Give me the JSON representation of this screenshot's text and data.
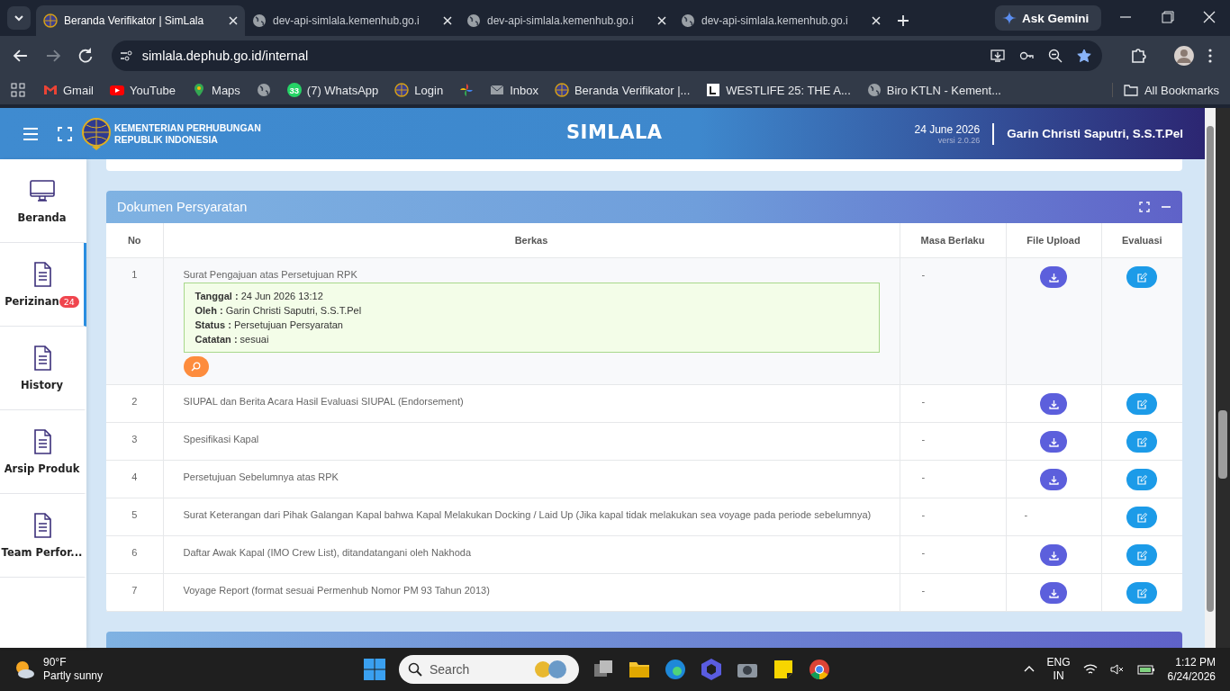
{
  "browser": {
    "tabs": [
      {
        "title": "Beranda Verifikator | SimLala",
        "selected": true,
        "kind": "emblem"
      },
      {
        "title": "dev-api-simlala.kemenhub.go.i",
        "selected": false,
        "kind": "globe"
      },
      {
        "title": "dev-api-simlala.kemenhub.go.i",
        "selected": false,
        "kind": "globe"
      },
      {
        "title": "dev-api-simlala.kemenhub.go.i",
        "selected": false,
        "kind": "globe"
      }
    ],
    "ask_gemini": "Ask Gemini",
    "address": "simlala.dephub.go.id/internal",
    "bookmarked": true,
    "bookmarks": [
      {
        "kind": "gmail",
        "label": "Gmail"
      },
      {
        "kind": "youtube",
        "label": "YouTube"
      },
      {
        "kind": "maps",
        "label": "Maps"
      },
      {
        "kind": "globe"
      },
      {
        "kind": "whatsapp",
        "badge": "33",
        "label": "(7) WhatsApp"
      },
      {
        "kind": "emblem",
        "label": "Login"
      },
      {
        "kind": "pinwheel"
      },
      {
        "kind": "mail",
        "label": "Inbox"
      },
      {
        "kind": "emblem",
        "label": "Beranda Verifikator |..."
      },
      {
        "kind": "letter",
        "label": "WESTLIFE 25: THE A..."
      },
      {
        "kind": "globe",
        "label": "Biro KTLN - Kement..."
      }
    ],
    "all_bookmarks": "All Bookmarks"
  },
  "header": {
    "ministry": [
      "KEMENTERIAN PERHUBUNGAN",
      "REPUBLIK INDONESIA"
    ],
    "title": "SIMLALA",
    "date": "24 June 2026",
    "version": "versi 2.0.26",
    "user": "Garin Christi Saputri, S.S.T.Pel"
  },
  "sidebar": {
    "items": [
      {
        "kind": "monitor",
        "label": "Beranda",
        "selected": false
      },
      {
        "kind": "document",
        "label": "Perizinan",
        "selected": true,
        "badge": "24"
      },
      {
        "kind": "document",
        "label": "History",
        "selected": false
      },
      {
        "kind": "document",
        "label": "Arsip Produk",
        "selected": false
      },
      {
        "kind": "document",
        "label": "Team Perfor...",
        "selected": false
      }
    ]
  },
  "panel": {
    "title": "Dokumen Persyaratan",
    "columns": [
      "No",
      "Berkas",
      "Masa Berlaku",
      "File Upload",
      "Evaluasi"
    ],
    "rows": [
      {
        "no": "1",
        "berkas": "Surat Pengajuan atas Persetujuan RPK",
        "masa_berlaku": "-",
        "detail": [
          "**Tanggal :** 24 Jun 2026 13:12",
          "**Oleh :** Garin Christi Saputri, S.S.T.Pel",
          "**Status :** Persetujuan Persyaratan",
          "**Catatan :** sesuai"
        ]
      },
      {
        "no": "2",
        "berkas": "SIUPAL dan Berita Acara Hasil Evaluasi SIUPAL (Endorsement)",
        "masa_berlaku": "-"
      },
      {
        "no": "3",
        "berkas": "Spesifikasi Kapal",
        "masa_berlaku": "-"
      },
      {
        "no": "4",
        "berkas": "Persetujuan Sebelumnya atas RPK",
        "masa_berlaku": "-"
      },
      {
        "no": "5",
        "berkas": "Surat Keterangan dari Pihak Galangan Kapal bahwa Kapal Melakukan Docking / Laid Up (Jika kapal tidak melakukan sea voyage pada periode sebelumnya)",
        "masa_berlaku": "-",
        "file_upload": "-"
      },
      {
        "no": "6",
        "berkas": "Daftar Awak Kapal (IMO Crew List), ditandatangani oleh Nakhoda",
        "masa_berlaku": "-"
      },
      {
        "no": "7",
        "berkas": "Voyage Report (format sesuai Permenhub Nomor PM 93 Tahun 2013)",
        "masa_berlaku": "-"
      }
    ]
  },
  "taskbar": {
    "temperature": "90°F",
    "weather": "Partly sunny",
    "search_placeholder": "Search",
    "language": [
      "ENG",
      "IN"
    ],
    "time": "1:12 PM",
    "date": "6/24/2026"
  }
}
